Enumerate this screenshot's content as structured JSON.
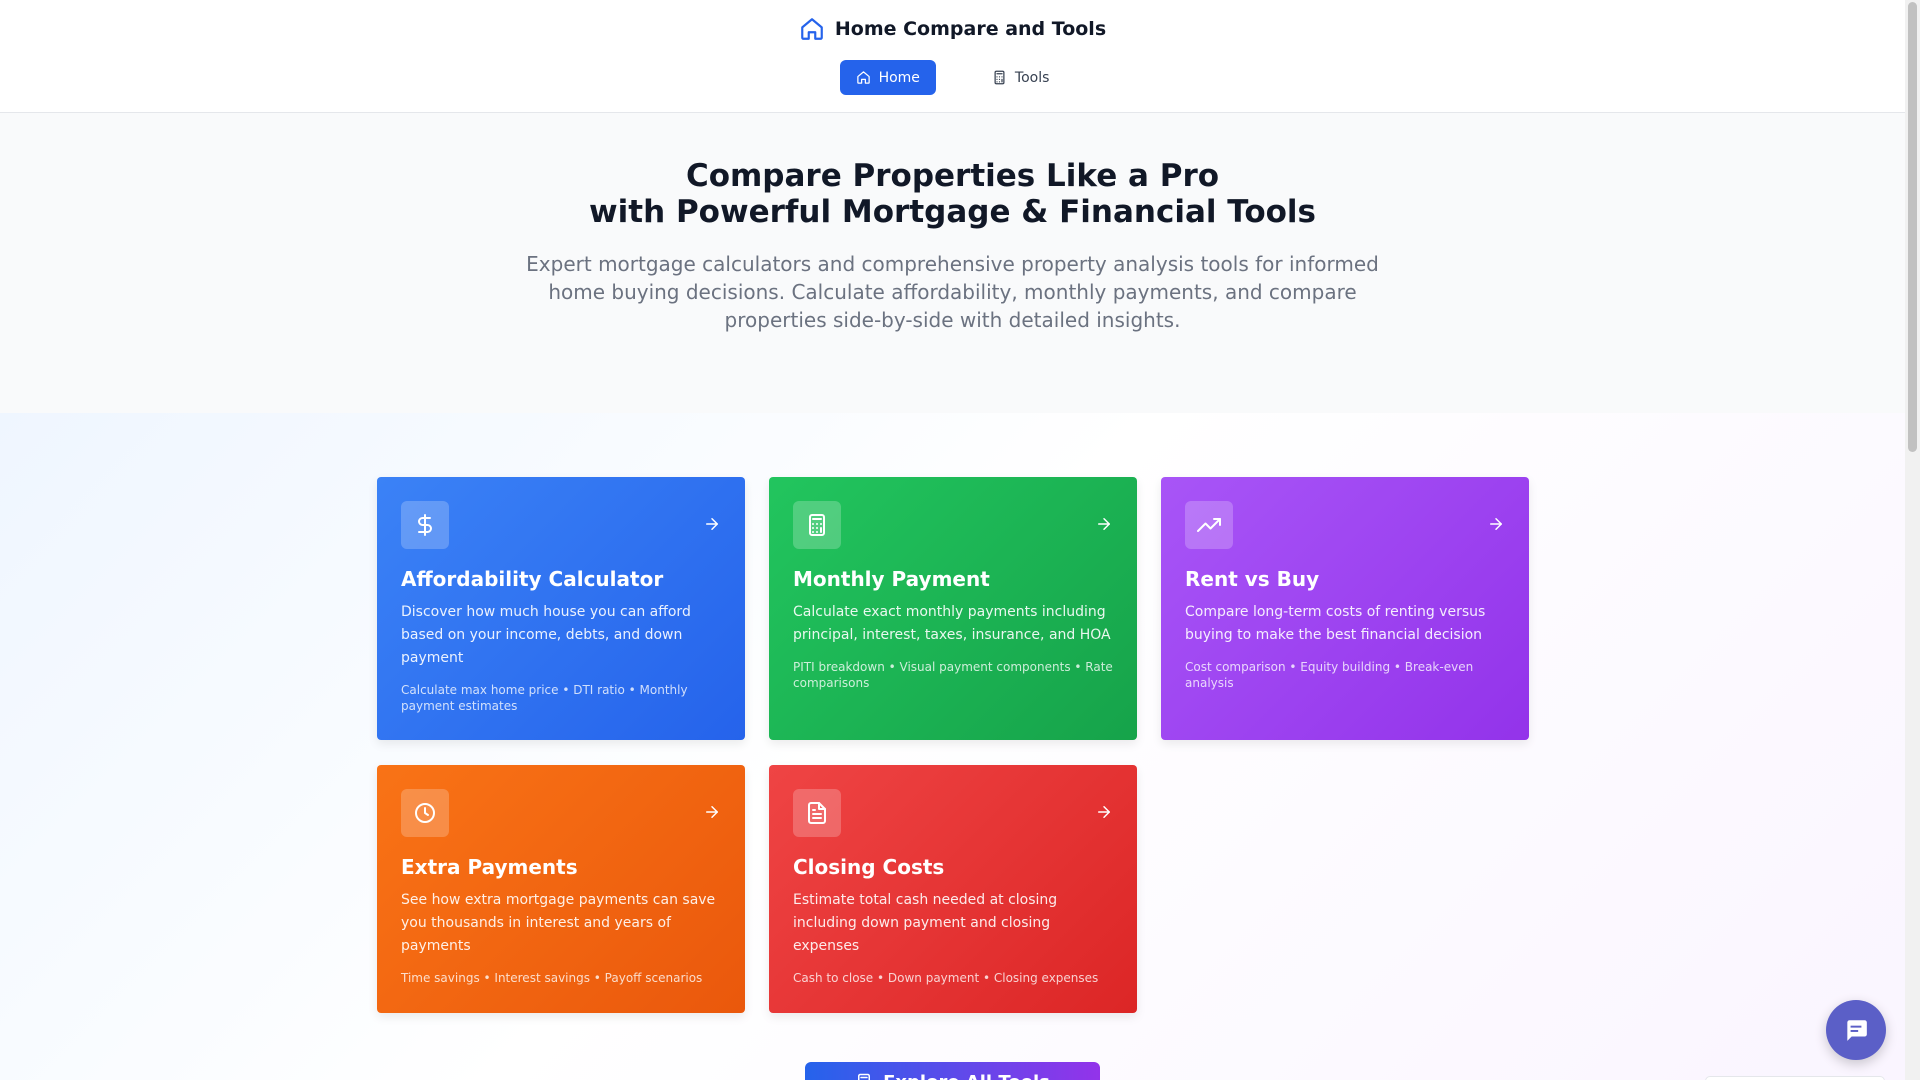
{
  "header": {
    "brand_title": "Home Compare and Tools",
    "nav": [
      {
        "label": "Home",
        "icon": "home-icon",
        "active": true
      },
      {
        "label": "Tools",
        "icon": "calculator-icon",
        "active": false
      }
    ]
  },
  "hero": {
    "title_line1": "Compare Properties Like a Pro",
    "title_line2": "with Powerful Mortgage & Financial Tools",
    "subtitle": "Expert mortgage calculators and comprehensive property analysis tools for informed home buying decisions. Calculate affordability, monthly payments, and compare properties side-by-side with detailed insights."
  },
  "tools": [
    {
      "title": "Affordability Calculator",
      "icon": "dollar-icon",
      "color": "#2563eb",
      "description": "Discover how much house you can afford based on your income, debts, and down payment",
      "features": "Calculate max home price • DTI ratio • Monthly payment estimates"
    },
    {
      "title": "Monthly Payment",
      "icon": "calculator-icon",
      "color": "#16a34a",
      "description": "Calculate exact monthly payments including principal, interest, taxes, insurance, and HOA",
      "features": "PITI breakdown • Visual payment components • Rate comparisons"
    },
    {
      "title": "Rent vs Buy",
      "icon": "trending-up-icon",
      "color": "#9333ea",
      "description": "Compare long-term costs of renting versus buying to make the best financial decision",
      "features": "Cost comparison • Equity building • Break-even analysis"
    },
    {
      "title": "Extra Payments",
      "icon": "clock-icon",
      "color": "#ea580c",
      "description": "See how extra mortgage payments can save you thousands in interest and years of payments",
      "features": "Time savings • Interest savings • Payoff scenarios"
    },
    {
      "title": "Closing Costs",
      "icon": "document-icon",
      "color": "#dc2626",
      "description": "Estimate total cash needed at closing including down payment and closing expenses",
      "features": "Cash to close • Down payment • Closing expenses"
    }
  ],
  "explore_button": {
    "label": "Explore All Tools",
    "icon": "calculator-icon"
  },
  "chat": {
    "icon": "chat-icon"
  }
}
